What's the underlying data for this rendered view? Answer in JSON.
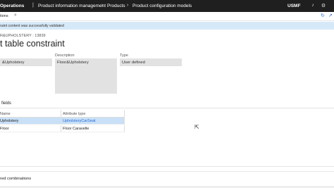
{
  "topbar": {
    "app_name": "Operations",
    "crumbs": [
      "Product information management",
      "Products",
      "Product configuration models"
    ],
    "company": "USMF",
    "icons": [
      "bell-icon",
      "gear-icon"
    ]
  },
  "actionbar": {
    "options_label": "tions",
    "search_icon": "search-icon",
    "right_icons": [
      "refresh-icon",
      "link-icon"
    ]
  },
  "banner": {
    "message": "raint content was successfully validated"
  },
  "record": {
    "id_line": "R&UPHOLSTERY : 13839",
    "title": "t table constraint"
  },
  "fields": {
    "name_value": "&Upholstery",
    "description_label": "Description",
    "description_value": "Floor&Upholstery",
    "type_label": "Type",
    "type_value": "User defined"
  },
  "fields_section": {
    "title": "fields"
  },
  "grid": {
    "columns": [
      "Name",
      "Attribute type"
    ],
    "rows": [
      {
        "name": "Upholstery",
        "type": "UpholsteryCarSeat",
        "selected": true
      },
      {
        "name": "Floor",
        "type": "Floor Caravelle",
        "selected": false
      }
    ]
  },
  "combinations_section": {
    "title": "red combinations"
  },
  "colors": {
    "topbar_bg": "#1f1f1f",
    "banner_bg": "#d6e9f8",
    "selected_row": "#c9e0f7",
    "link_blue": "#2a6fd6"
  }
}
